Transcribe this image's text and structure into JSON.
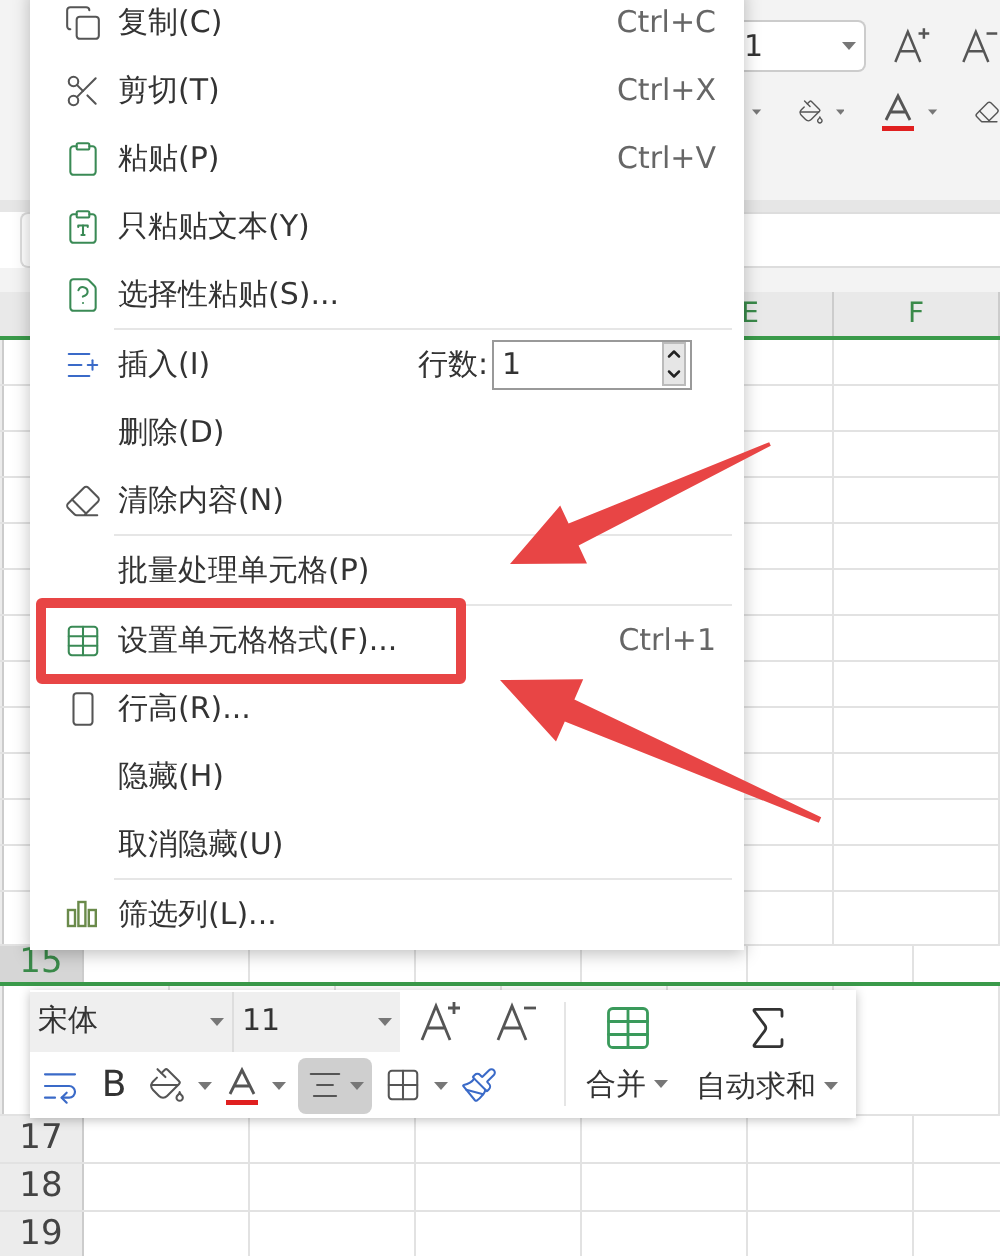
{
  "ribbon": {
    "font_size": "1"
  },
  "columns": [
    {
      "label": "E"
    },
    {
      "label": "F"
    }
  ],
  "rows": [
    {
      "label": "15",
      "selected": true
    },
    {
      "label": "17",
      "selected": false
    },
    {
      "label": "18",
      "selected": false
    },
    {
      "label": "19",
      "selected": false
    }
  ],
  "context_menu": {
    "items": [
      {
        "label": "复制(C)",
        "shortcut": "Ctrl+C",
        "separator_before": false
      },
      {
        "label": "剪切(T)",
        "shortcut": "Ctrl+X",
        "separator_before": false
      },
      {
        "label": "粘贴(P)",
        "shortcut": "Ctrl+V",
        "separator_before": false
      },
      {
        "label": "只粘贴文本(Y)",
        "separator_before": false
      },
      {
        "label": "选择性粘贴(S)...",
        "separator_before": false
      },
      {
        "label": "插入(I)",
        "kind": "count",
        "count_label": "行数:",
        "count_value": "1",
        "separator_before": true
      },
      {
        "label": "删除(D)",
        "separator_before": false
      },
      {
        "label": "清除内容(N)",
        "separator_before": false
      },
      {
        "label": "批量处理单元格(P)",
        "separator_before": true
      },
      {
        "label": "设置单元格格式(F)...",
        "shortcut": "Ctrl+1",
        "separator_before": true
      },
      {
        "label": "行高(R)...",
        "separator_before": false
      },
      {
        "label": "隐藏(H)",
        "separator_before": false
      },
      {
        "label": "取消隐藏(U)",
        "separator_before": false
      },
      {
        "label": "筛选列(L)...",
        "separator_before": true
      }
    ]
  },
  "mini_toolbar": {
    "font": "宋体",
    "size": "11",
    "bold": "B",
    "align_selected": true,
    "merge": "合并",
    "autosum": "自动求和"
  }
}
